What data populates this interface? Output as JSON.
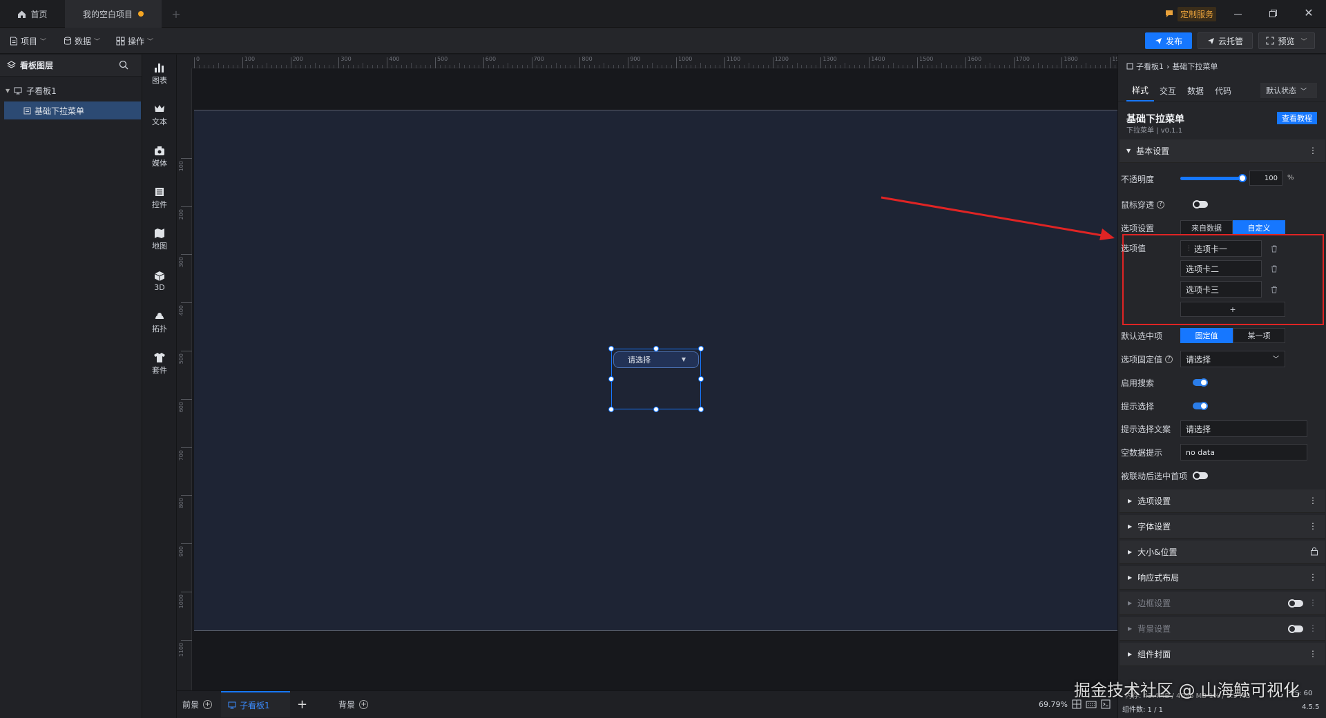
{
  "titlebar": {
    "home_tab": "首页",
    "project_tab": "我的空白项目",
    "custom_service": "定制服务"
  },
  "toolbar": {
    "menu_project": "项目",
    "menu_data": "数据",
    "menu_ops": "操作",
    "publish": "发布",
    "cloud_host": "云托管",
    "preview": "预览"
  },
  "layers": {
    "title": "看板图层",
    "board": "子看板1",
    "component": "基础下拉菜单"
  },
  "iconbar": {
    "items": [
      "图表",
      "文本",
      "媒体",
      "控件",
      "地图",
      "3D",
      "拓扑",
      "套件"
    ]
  },
  "ruler": {
    "h_ticks": [
      "0",
      "100",
      "200",
      "300",
      "400",
      "500",
      "600",
      "700",
      "800",
      "900",
      "1000",
      "1100",
      "1200",
      "1300",
      "1400",
      "1500",
      "1600",
      "1700",
      "1800",
      "1900"
    ],
    "v_ticks": [
      "100",
      "200",
      "300",
      "400",
      "500",
      "600",
      "700",
      "800",
      "900",
      "1000",
      "1100"
    ]
  },
  "canvas": {
    "dropdown_placeholder": "请选择"
  },
  "bottombar": {
    "foreground": "前景",
    "board_tab": "子看板1",
    "background": "背景",
    "zoom": "69.79%"
  },
  "rpanel": {
    "breadcrumb_parent": "子看板1",
    "breadcrumb_current": "基础下拉菜单",
    "tabs": [
      "样式",
      "交互",
      "数据",
      "代码"
    ],
    "state_select": "默认状态",
    "component_title": "基础下拉菜单",
    "component_subtitle": "下拉菜单 | v0.1.1",
    "tutorial_button": "查看教程",
    "basic_section": "基本设置",
    "opacity_label": "不透明度",
    "opacity_value": "100",
    "opacity_unit": "%",
    "opacity_fraction": 1.0,
    "mouse_through_label": "鼠标穿透",
    "options_setting_label": "选项设置",
    "options_from_data": "来自数据",
    "options_custom": "自定义",
    "option_values_label": "选项值",
    "option_values": [
      "选项卡一",
      "选项卡二",
      "选项卡三"
    ],
    "add_option": "+",
    "default_selected_label": "默认选中项",
    "default_fixed": "固定值",
    "default_some": "某一项",
    "fixed_value_label": "选项固定值",
    "fixed_value_select": "请选择",
    "enable_search_label": "启用搜索",
    "prompt_select_label": "提示选择",
    "prompt_text_label": "提示选择文案",
    "prompt_text_value": "请选择",
    "empty_hint_label": "空数据提示",
    "empty_hint_value": "no data",
    "linked_select_first_label": "被联动后选中首项",
    "sections": [
      "选项设置",
      "字体设置",
      "大小&位置",
      "响应式布局",
      "边框设置",
      "背景设置",
      "组件封面"
    ],
    "component_count": "组件数: 1 / 1",
    "version": "4.5.5",
    "fps_label": "FPS: 60",
    "memory_text": "内存: 43.4MB / 4096 MB 1% / 5.9 MB"
  },
  "watermark": "掘金技术社区 @ 山海鲸可视化",
  "colors": {
    "accent": "#1677ff",
    "highlight_box": "#e02424",
    "arrow": "#e02424",
    "board_bg": "#1e2434"
  }
}
